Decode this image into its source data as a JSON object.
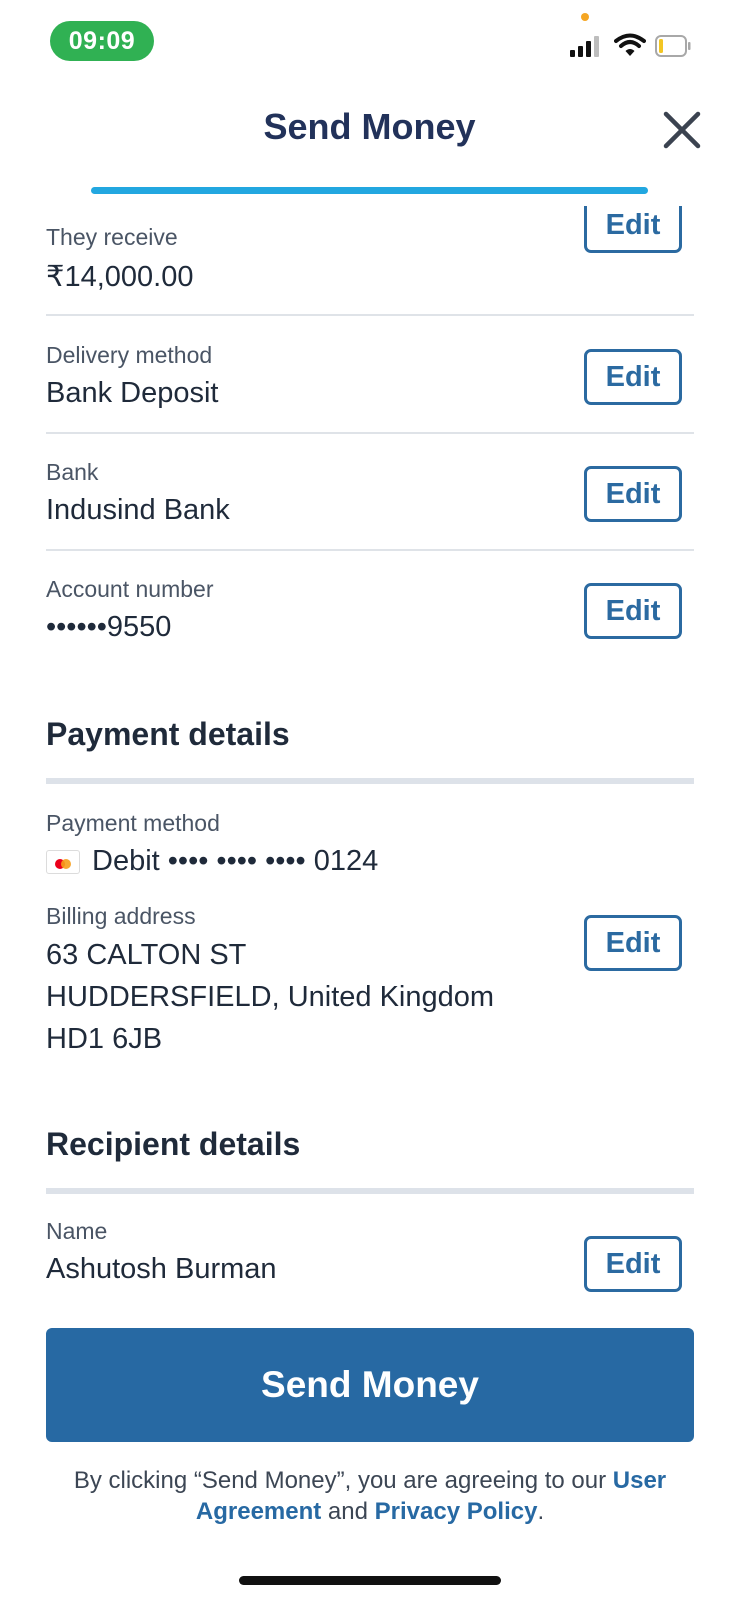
{
  "status_bar": {
    "time": "09:09",
    "time_pill_color": "#30b153"
  },
  "header": {
    "title": "Send Money",
    "close_icon": "close-icon",
    "progress_color": "#22a7e0"
  },
  "transfer_details": {
    "rows": [
      {
        "label": "They receive",
        "value": "₹14,000.00",
        "edit_label": "Edit"
      },
      {
        "label": "Delivery method",
        "value": "Bank Deposit",
        "edit_label": "Edit"
      },
      {
        "label": "Bank",
        "value": "Indusind Bank",
        "edit_label": "Edit"
      },
      {
        "label": "Account number",
        "value": "••••••9550",
        "edit_label": "Edit"
      }
    ]
  },
  "payment_details": {
    "title": "Payment details",
    "method_label": "Payment method",
    "method_value": "Debit •••• •••• •••• 0124",
    "card_icon": "mastercard-icon",
    "billing_label": "Billing address",
    "billing_lines": [
      "63 CALTON ST",
      "HUDDERSFIELD, United Kingdom",
      "HD1 6JB"
    ],
    "edit_label": "Edit"
  },
  "recipient_details": {
    "title": "Recipient details",
    "name_label": "Name",
    "name_value": "Ashutosh Burman",
    "edit_label": "Edit"
  },
  "footer": {
    "send_button": "Send Money",
    "legal_prefix": "By clicking “Send Money”, you are agreeing to our ",
    "user_agreement": "User Agreement",
    "legal_and": " and ",
    "privacy_policy": "Privacy Policy",
    "legal_suffix": ".",
    "primary_color": "#2769a3"
  }
}
